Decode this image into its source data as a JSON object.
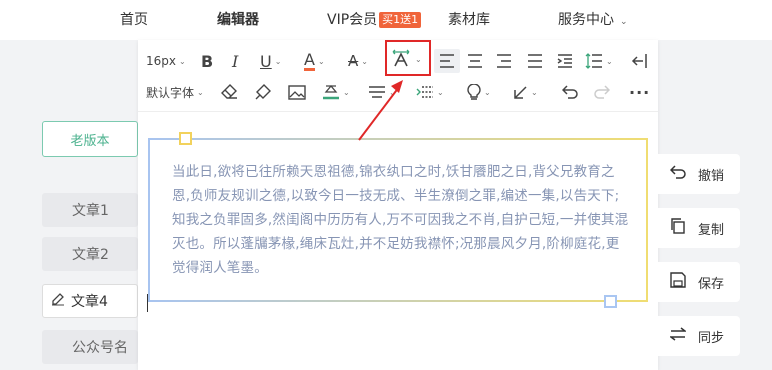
{
  "nav": {
    "home": "首页",
    "editor": "编辑器",
    "vip": "VIP会员",
    "vip_badge": "买1送1",
    "materials": "素材库",
    "service": "服务中心"
  },
  "toolbar": {
    "font_size": "16px",
    "font_family": "默认字体"
  },
  "sidebar": {
    "old_version": "老版本",
    "items": [
      {
        "label": "文章1"
      },
      {
        "label": "文章2"
      },
      {
        "label": "文章4"
      },
      {
        "label": "公众号名"
      }
    ]
  },
  "content": {
    "text": "当此日,欲将已往所赖天恩祖德,锦衣纨口之时,饫甘餍肥之日,背父兄教育之恩,负师友规训之德,以致今日一技无成、半生潦倒之罪,编述一集,以告天下;知我之负罪固多,然闺阁中历历有人,万不可因我之不肖,自护己短,一并使其混灭也。所以蓬牖茅椽,绳床瓦灶,并不足妨我襟怀;况那晨风夕月,阶柳庭花,更觉得润人笔墨。"
  },
  "actions": {
    "undo": "撤销",
    "copy": "复制",
    "save": "保存",
    "sync": "同步"
  },
  "colors": {
    "accent_green": "#4bb28e",
    "highlight_red": "#e02828",
    "text_muted": "#8795b4",
    "badge_orange": "#f0643a"
  },
  "icons": [
    "bold-icon",
    "italic-icon",
    "underline-icon",
    "font-color-icon",
    "strikethrough-icon",
    "text-spacing-icon",
    "align-left-icon",
    "align-center-icon",
    "align-right-icon",
    "justify-icon",
    "indent-icon",
    "line-height-icon",
    "exit-icon",
    "eraser-icon",
    "format-brush-icon",
    "image-icon",
    "background-color-icon",
    "divider-icon",
    "spacing-icon",
    "lightbulb-icon",
    "arrow-icon",
    "undo-icon",
    "redo-icon",
    "more-icon",
    "copy-icon",
    "save-icon",
    "sync-icon",
    "edit-pen-icon"
  ]
}
